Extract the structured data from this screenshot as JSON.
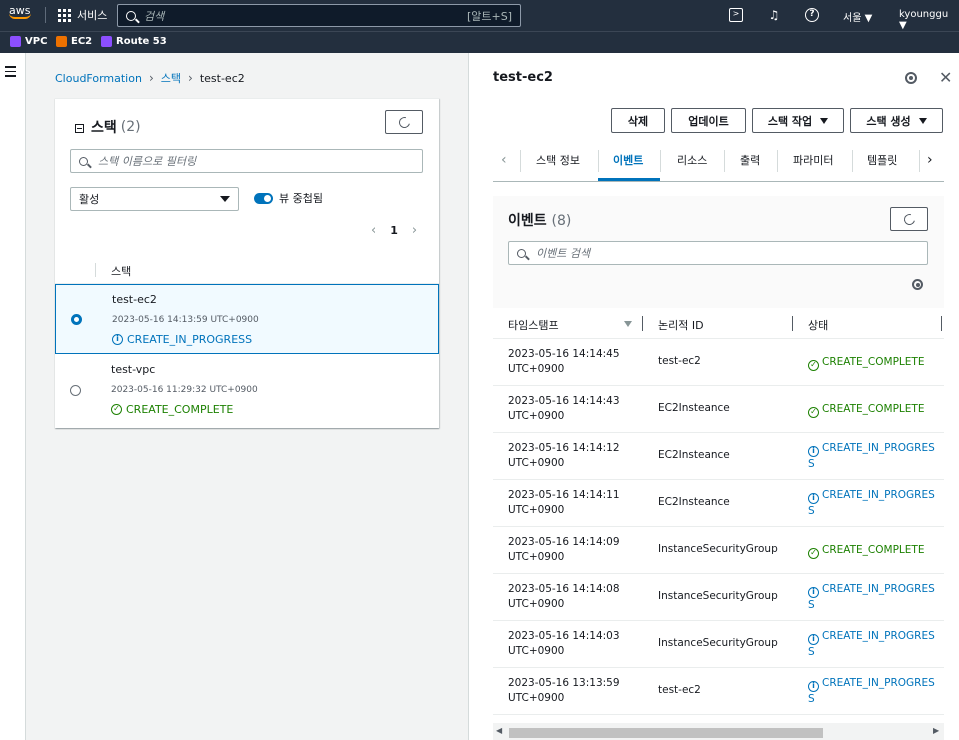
{
  "topbar": {
    "logo": "aws",
    "services_label": "서비스",
    "search_placeholder": "검색",
    "search_shortcut": "[알트+S]",
    "region": "서울 ▼",
    "user": "kyounggu ▼",
    "icons": [
      "grid-icon",
      "search-icon",
      "cloudshell-icon",
      "notifications-icon",
      "help-icon"
    ]
  },
  "favorites": [
    {
      "label": "VPC",
      "color": "#8c4fff"
    },
    {
      "label": "EC2",
      "color": "#ed7100"
    },
    {
      "label": "Route 53",
      "color": "#8c4fff"
    }
  ],
  "breadcrumb": {
    "items": [
      "CloudFormation",
      "스택"
    ],
    "current": "test-ec2"
  },
  "stacks_panel": {
    "title": "스택",
    "count": "(2)",
    "filter_placeholder": "스택 이름으로 필터링",
    "status_select": "활성",
    "toggle_label": "뷰 중첩됨",
    "toggle_on": true,
    "page": "1",
    "column_header": "스택",
    "stacks": [
      {
        "name": "test-ec2",
        "date": "2023-05-16 14:13:59 UTC+0900",
        "status": "CREATE_IN_PROGRESS",
        "status_type": "info",
        "selected": true
      },
      {
        "name": "test-vpc",
        "date": "2023-05-16 11:29:32 UTC+0900",
        "status": "CREATE_COMPLETE",
        "status_type": "success",
        "selected": false
      }
    ]
  },
  "detail": {
    "title": "test-ec2",
    "buttons": {
      "delete": "삭제",
      "update": "업데이트",
      "stack_actions": "스택 작업",
      "create_stack": "스택 생성"
    },
    "tabs": [
      "스택 정보",
      "이벤트",
      "리소스",
      "출력",
      "파라미터",
      "템플릿"
    ],
    "active_tab": "이벤트"
  },
  "events": {
    "title": "이벤트",
    "count": "(8)",
    "search_placeholder": "이벤트 검색",
    "columns": [
      "타임스탬프",
      "논리적 ID",
      "상태"
    ],
    "rows": [
      {
        "ts1": "2023-05-16 14:14:45",
        "ts2": "UTC+0900",
        "id": "test-ec2",
        "s1": "CREATE_COMPLETE",
        "s2": "",
        "type": "success"
      },
      {
        "ts1": "2023-05-16 14:14:43",
        "ts2": "UTC+0900",
        "id": "EC2Insteance",
        "s1": "CREATE_COMPLETE",
        "s2": "",
        "type": "success"
      },
      {
        "ts1": "2023-05-16 14:14:12",
        "ts2": "UTC+0900",
        "id": "EC2Insteance",
        "s1": "CREATE_IN_PROGRES",
        "s2": "S",
        "type": "info"
      },
      {
        "ts1": "2023-05-16 14:14:11",
        "ts2": "UTC+0900",
        "id": "EC2Insteance",
        "s1": "CREATE_IN_PROGRES",
        "s2": "S",
        "type": "info"
      },
      {
        "ts1": "2023-05-16 14:14:09",
        "ts2": "UTC+0900",
        "id": "InstanceSecurityGroup",
        "s1": "CREATE_COMPLETE",
        "s2": "",
        "type": "success"
      },
      {
        "ts1": "2023-05-16 14:14:08",
        "ts2": "UTC+0900",
        "id": "InstanceSecurityGroup",
        "s1": "CREATE_IN_PROGRES",
        "s2": "S",
        "type": "info"
      },
      {
        "ts1": "2023-05-16 14:14:03",
        "ts2": "UTC+0900",
        "id": "InstanceSecurityGroup",
        "s1": "CREATE_IN_PROGRES",
        "s2": "S",
        "type": "info"
      },
      {
        "ts1": "2023-05-16 13:13:59",
        "ts2": "UTC+0900",
        "id": "test-ec2",
        "s1": "CREATE_IN_PROGRES",
        "s2": "S",
        "type": "info"
      }
    ]
  },
  "colors": {
    "topbar": "#232f3e",
    "link": "#0073bb",
    "success": "#1d8102",
    "info": "#0073bb"
  }
}
